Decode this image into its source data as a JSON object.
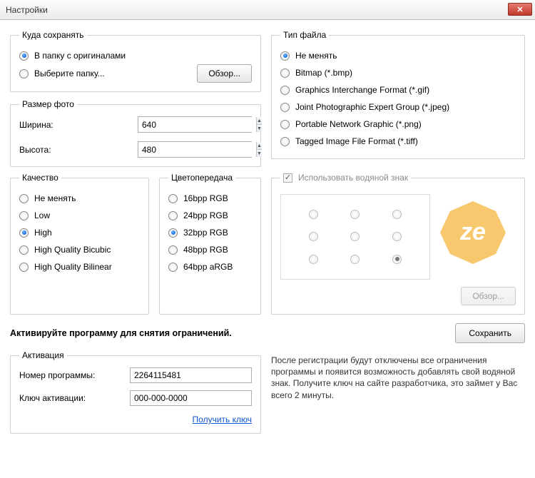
{
  "window": {
    "title": "Настройки"
  },
  "saveWhere": {
    "legend": "Куда сохранять",
    "opt1": "В папку с оригиналами",
    "opt2": "Выберите папку...",
    "browse": "Обзор..."
  },
  "size": {
    "legend": "Размер фото",
    "widthLabel": "Ширина:",
    "heightLabel": "Высота:",
    "width": "640",
    "height": "480"
  },
  "quality": {
    "legend": "Качество",
    "opts": [
      "Не менять",
      "Low",
      "High",
      "High Quality Bicubic",
      "High Quality Bilinear"
    ],
    "selected": 2
  },
  "color": {
    "legend": "Цветопередача",
    "opts": [
      "16bpp RGB",
      "24bpp RGB",
      "32bpp RGB",
      "48bpp RGB",
      "64bpp aRGB"
    ],
    "selected": 2
  },
  "fileType": {
    "legend": "Тип файла",
    "opts": [
      "Не менять",
      "Bitmap (*.bmp)",
      "Graphics Interchange Format (*.gif)",
      "Joint Photographic Expert Group (*.jpeg)",
      "Portable Network Graphic (*.png)",
      "Tagged Image File Format (*.tiff)"
    ],
    "selected": 0
  },
  "watermark": {
    "useLabel": "Использовать водяной знак",
    "browse": "Обзор...",
    "selectedPos": 8
  },
  "buttons": {
    "save": "Сохранить"
  },
  "activateMsg": "Активируйте программу для снятия ограничений.",
  "activation": {
    "legend": "Активация",
    "numLabel": "Номер программы:",
    "numValue": "2264115481",
    "keyLabel": "Ключ активации:",
    "keyValue": "000-000-0000",
    "getKey": "Получить ключ"
  },
  "regDesc": "После регистрации будут отключены все ограничения программы и появится возможность добавлять свой водяной знак. Получите ключ на сайте разработчика, это займет у Вас всего 2 минуты."
}
